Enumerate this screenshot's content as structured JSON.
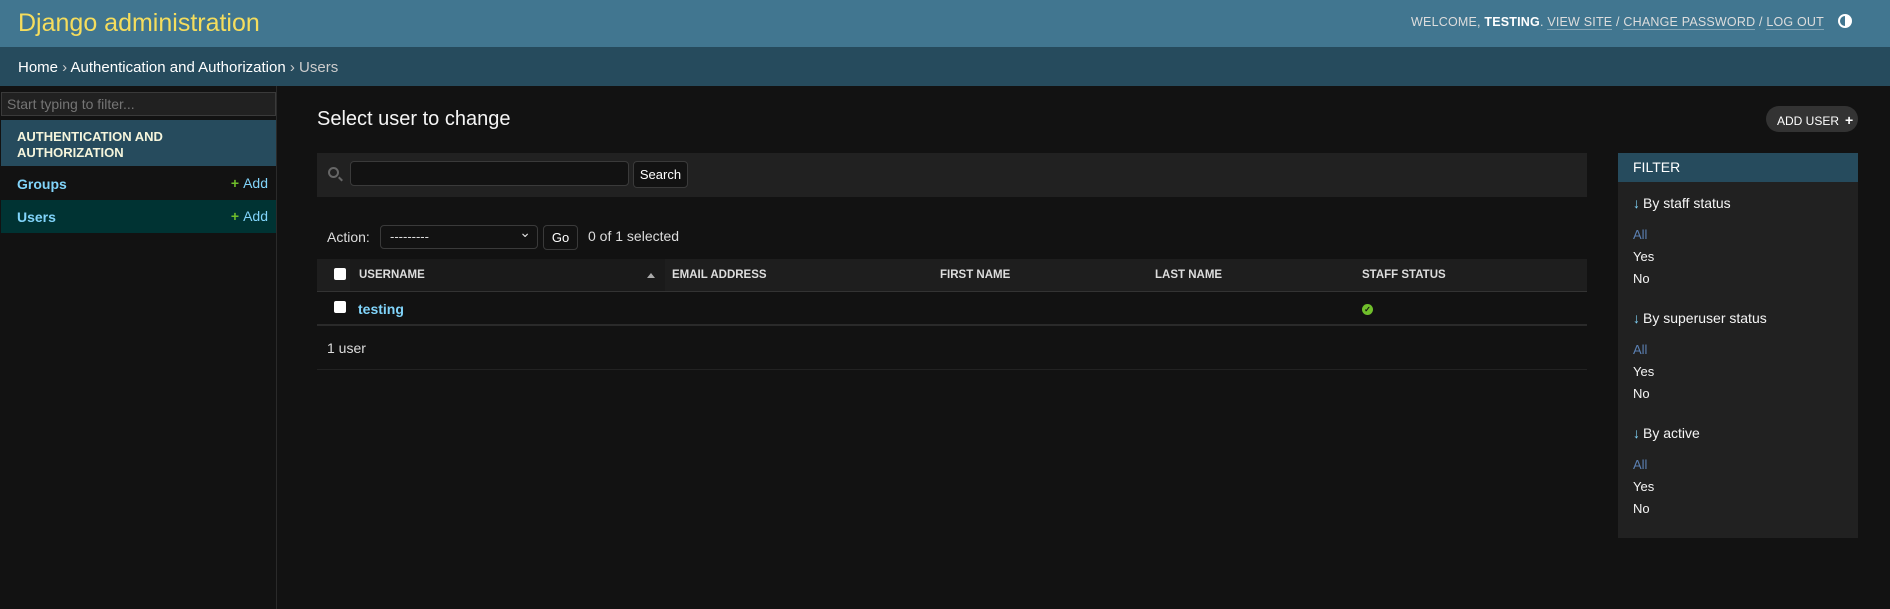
{
  "header": {
    "brand": "Django administration",
    "welcome": "WELCOME, ",
    "user": "TESTING",
    "view_site": "VIEW SITE",
    "change_password": "CHANGE PASSWORD",
    "log_out": "LOG OUT",
    "sep": " / "
  },
  "breadcrumbs": {
    "home": "Home",
    "app": "Authentication and Authorization",
    "current": "Users",
    "sep": " › "
  },
  "sidebar": {
    "filter_placeholder": "Start typing to filter...",
    "app": "AUTHENTICATION AND AUTHORIZATION",
    "models": [
      {
        "name": "Groups",
        "add": "Add"
      },
      {
        "name": "Users",
        "add": "Add"
      }
    ]
  },
  "main": {
    "title": "Select user to change",
    "add_button": "ADD USER",
    "search_button": "Search",
    "search_value": "",
    "action_label": "Action:",
    "action_selected": "---------",
    "go": "Go",
    "selected_count": "0 of 1 selected",
    "columns": [
      "USERNAME",
      "EMAIL ADDRESS",
      "FIRST NAME",
      "LAST NAME",
      "STAFF STATUS"
    ],
    "rows": [
      {
        "username": "testing",
        "email": "",
        "first_name": "",
        "last_name": "",
        "staff_status": true
      }
    ],
    "result_count": "1 user"
  },
  "filter": {
    "title": "FILTER",
    "groups": [
      {
        "title": "By staff status",
        "options": [
          "All",
          "Yes",
          "No"
        ]
      },
      {
        "title": "By superuser status",
        "options": [
          "All",
          "Yes",
          "No"
        ]
      },
      {
        "title": "By active",
        "options": [
          "All",
          "Yes",
          "No"
        ]
      }
    ],
    "arrow": "↓"
  },
  "colors": {
    "header": "#417690",
    "breadcrumbs": "#264b5d",
    "brand": "#f5dd5d",
    "link": "#81d4fa",
    "add": "#70bf2b"
  }
}
